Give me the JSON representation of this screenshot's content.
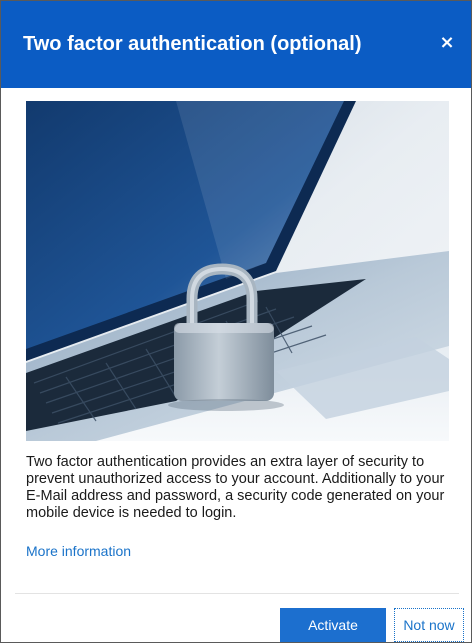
{
  "dialog": {
    "title": "Two factor authentication (optional)",
    "close_icon": "close-icon",
    "close_glyph": "×"
  },
  "image": {
    "subject": "laptop-with-padlock-illustration"
  },
  "body": {
    "description": "Two factor authentication provides an extra layer of security to prevent unauthorized access to your account. Additionally to your E-Mail address and password, a security code generated on your mobile device is needed to login.",
    "more_info_label": "More information"
  },
  "buttons": {
    "activate_label": "Activate",
    "not_now_label": "Not now"
  },
  "colors": {
    "header_bg": "#0b5cc4",
    "primary_button": "#1c6fcf",
    "link": "#1a73c9",
    "text": "#1a1a1a"
  }
}
